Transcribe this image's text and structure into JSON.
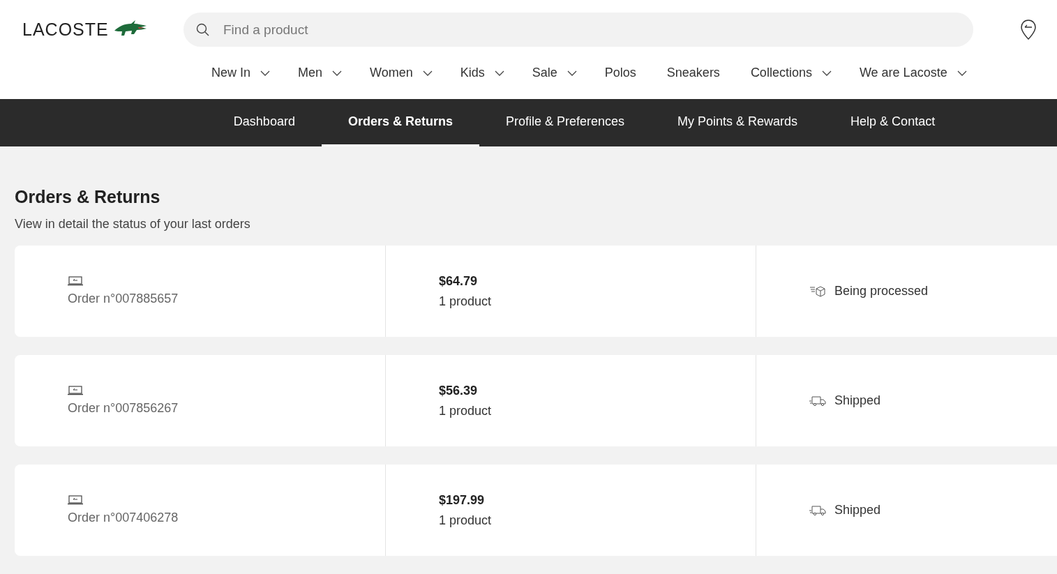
{
  "logo": {
    "text": "LACOSTE"
  },
  "search": {
    "placeholder": "Find a product"
  },
  "nav": [
    {
      "label": "New In",
      "has_menu": true
    },
    {
      "label": "Men",
      "has_menu": true
    },
    {
      "label": "Women",
      "has_menu": true
    },
    {
      "label": "Kids",
      "has_menu": true
    },
    {
      "label": "Sale",
      "has_menu": true
    },
    {
      "label": "Polos",
      "has_menu": false
    },
    {
      "label": "Sneakers",
      "has_menu": false
    },
    {
      "label": "Collections",
      "has_menu": true
    },
    {
      "label": "We are Lacoste",
      "has_menu": true
    }
  ],
  "account_tabs": [
    {
      "label": "Dashboard",
      "selected": false
    },
    {
      "label": "Orders & Returns",
      "selected": true
    },
    {
      "label": "Profile & Preferences",
      "selected": false
    },
    {
      "label": "My Points & Rewards",
      "selected": false
    },
    {
      "label": "Help & Contact",
      "selected": false
    }
  ],
  "page": {
    "title": "Orders & Returns",
    "subtitle": "View in detail the status of your last orders"
  },
  "orders": [
    {
      "number": "Order n°007885657",
      "total": "$64.79",
      "items": "1 product",
      "status": "Being processed",
      "kind": "processing"
    },
    {
      "number": "Order n°007856267",
      "total": "$56.39",
      "items": "1 product",
      "status": "Shipped",
      "kind": "shipped"
    },
    {
      "number": "Order n°007406278",
      "total": "$197.99",
      "items": "1 product",
      "status": "Shipped",
      "kind": "shipped"
    }
  ]
}
